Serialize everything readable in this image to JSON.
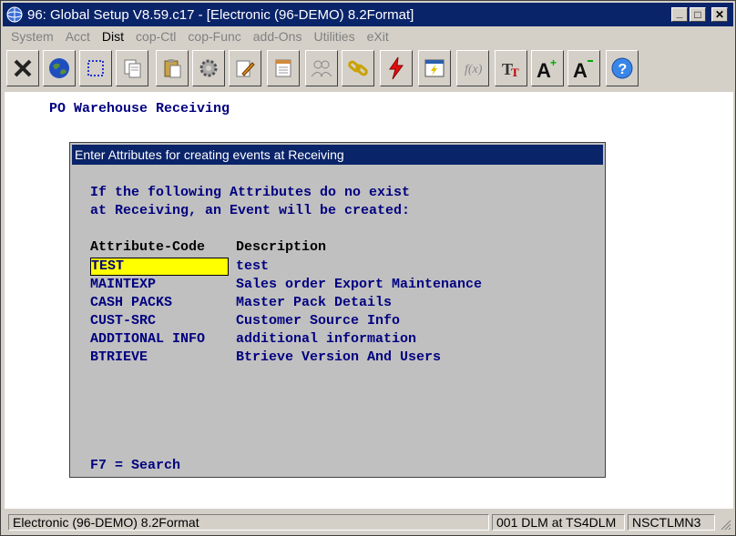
{
  "window": {
    "title": "96: Global Setup V8.59.c17 - [Electronic (96-DEMO) 8.2Format]",
    "minimize": "_",
    "maximize": "□",
    "close": "✕"
  },
  "menu": {
    "items": [
      {
        "label": "System",
        "enabled": false
      },
      {
        "label": "Acct",
        "enabled": false
      },
      {
        "label": "Dist",
        "enabled": true
      },
      {
        "label": "cop-Ctl",
        "enabled": false
      },
      {
        "label": "cop-Func",
        "enabled": false
      },
      {
        "label": "add-Ons",
        "enabled": false
      },
      {
        "label": "Utilities",
        "enabled": false
      },
      {
        "label": "eXit",
        "enabled": false
      }
    ]
  },
  "toolbar": {
    "buttons": [
      "close-x-icon",
      "globe-icon",
      "select-box-icon",
      "copy-icon",
      "paste-icon",
      "gear-icon",
      "edit-pencil-icon",
      "notepad-icon",
      "users-icon",
      "chain-link-icon",
      "lightning-icon",
      "calendar-icon",
      "function-icon",
      "font-size-icon",
      "font-increase-icon",
      "font-decrease-icon",
      "help-icon"
    ]
  },
  "screen": {
    "title": "PO Warehouse Receiving"
  },
  "dialog": {
    "title": "Enter Attributes for creating events at Receiving",
    "intro_line1": "If the following Attributes do no exist",
    "intro_line2": "at Receiving, an Event will be created:",
    "col_code": "Attribute-Code",
    "col_desc": "Description",
    "rows": [
      {
        "code": "TEST",
        "desc": "test"
      },
      {
        "code": "MAINTEXP",
        "desc": "Sales order Export Maintenance"
      },
      {
        "code": "CASH PACKS",
        "desc": "Master Pack Details"
      },
      {
        "code": "CUST-SRC",
        "desc": "Customer Source Info"
      },
      {
        "code": "ADDTIONAL INFO",
        "desc": "additional information"
      },
      {
        "code": "BTRIEVE",
        "desc": "Btrieve Version And Users"
      }
    ],
    "footer": "F7 = Search"
  },
  "status": {
    "company": "Electronic (96-DEMO) 8.2Format",
    "user": "001 DLM at TS4DLM",
    "station": "NSCTLMN3"
  }
}
